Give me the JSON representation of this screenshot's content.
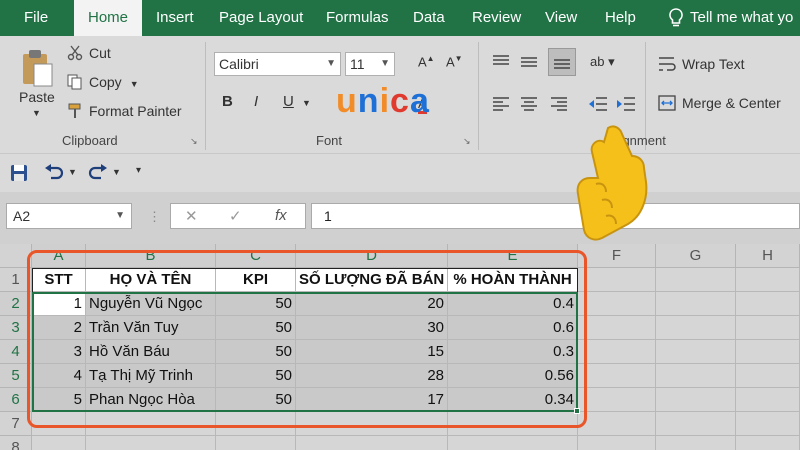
{
  "ribbon_tabs": [
    {
      "label": "File"
    },
    {
      "label": "Home"
    },
    {
      "label": "Insert"
    },
    {
      "label": "Page Layout"
    },
    {
      "label": "Formulas"
    },
    {
      "label": "Data"
    },
    {
      "label": "Review"
    },
    {
      "label": "View"
    },
    {
      "label": "Help"
    }
  ],
  "active_tab": "Home",
  "tell_me": "Tell me what yo",
  "clipboard": {
    "paste": "Paste",
    "cut": "Cut",
    "copy": "Copy",
    "format_painter": "Format Painter",
    "group": "Clipboard"
  },
  "font": {
    "family": "Calibri",
    "size": "11",
    "bold": "B",
    "italic": "I",
    "underline": "U",
    "group": "Font"
  },
  "alignment": {
    "wrap_text": "Wrap Text",
    "merge_center": "Merge & Center",
    "group": "Alignment"
  },
  "formula_bar": {
    "name_box": "A2",
    "cancel": "✕",
    "enter": "✓",
    "fx": "fx",
    "value": "1"
  },
  "logo": {
    "part1": "u",
    "part2": "n",
    "part3": "i",
    "part4": "c",
    "part5": "a"
  },
  "columns": [
    "A",
    "B",
    "C",
    "D",
    "E",
    "F",
    "G",
    "H"
  ],
  "rows": [
    "1",
    "2",
    "3",
    "4",
    "5",
    "6",
    "7",
    "8"
  ],
  "table": {
    "headers": [
      "STT",
      "HỌ VÀ TÊN",
      "KPI",
      "SỐ LƯỢNG ĐÃ BÁN",
      "% HOÀN THÀNH"
    ],
    "rows": [
      [
        "1",
        "Nguyễn Vũ Ngọc",
        "50",
        "20",
        "0.4"
      ],
      [
        "2",
        "Trần Văn Tuy",
        "50",
        "30",
        "0.6"
      ],
      [
        "3",
        "Hồ Văn Báu",
        "50",
        "15",
        "0.3"
      ],
      [
        "4",
        "Tạ Thị Mỹ Trinh",
        "50",
        "28",
        "0.56"
      ],
      [
        "5",
        "Phan Ngọc Hòa",
        "50",
        "17",
        "0.34"
      ]
    ]
  },
  "colors": {
    "excel_green": "#217346",
    "highlight": "#e8562a",
    "hand": "#f5c01a"
  }
}
